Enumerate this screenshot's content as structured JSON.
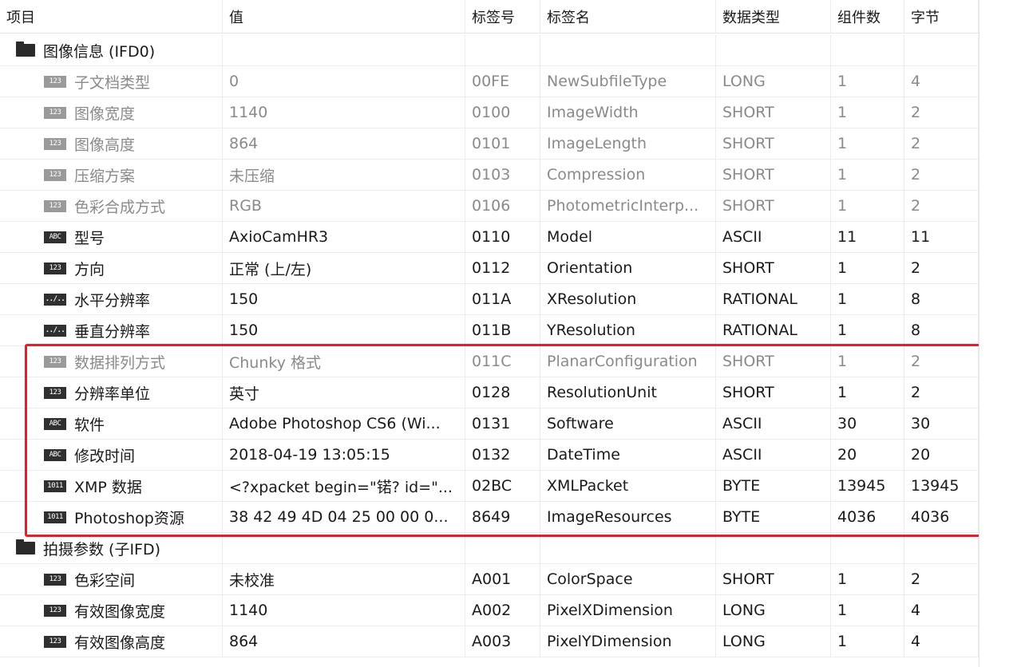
{
  "headers": [
    "项目",
    "值",
    "标签号",
    "标签名",
    "数据类型",
    "组件数",
    "字节"
  ],
  "rows": [
    {
      "kind": "group",
      "name": "图像信息 (IFD0)"
    },
    {
      "kind": "entry",
      "dim": true,
      "icon": "123",
      "name": "子文档类型",
      "value": "0",
      "tag": "00FE",
      "tagname": "NewSubfileType",
      "type": "LONG",
      "count": "1",
      "bytes": "4"
    },
    {
      "kind": "entry",
      "dim": true,
      "icon": "123",
      "name": "图像宽度",
      "value": "1140",
      "tag": "0100",
      "tagname": "ImageWidth",
      "type": "SHORT",
      "count": "1",
      "bytes": "2"
    },
    {
      "kind": "entry",
      "dim": true,
      "icon": "123",
      "name": "图像高度",
      "value": "864",
      "tag": "0101",
      "tagname": "ImageLength",
      "type": "SHORT",
      "count": "1",
      "bytes": "2"
    },
    {
      "kind": "entry",
      "dim": true,
      "icon": "123",
      "name": "压缩方案",
      "value": "未压缩",
      "tag": "0103",
      "tagname": "Compression",
      "type": "SHORT",
      "count": "1",
      "bytes": "2"
    },
    {
      "kind": "entry",
      "dim": true,
      "icon": "123",
      "name": "色彩合成方式",
      "value": "RGB",
      "tag": "0106",
      "tagname": "PhotometricInterp...",
      "type": "SHORT",
      "count": "1",
      "bytes": "2"
    },
    {
      "kind": "entry",
      "dim": false,
      "icon": "ABC",
      "name": "型号",
      "value": "AxioCamHR3",
      "tag": "0110",
      "tagname": "Model",
      "type": "ASCII",
      "count": "11",
      "bytes": "11"
    },
    {
      "kind": "entry",
      "dim": false,
      "icon": "123",
      "name": "方向",
      "value": "正常 (上/左)",
      "tag": "0112",
      "tagname": "Orientation",
      "type": "SHORT",
      "count": "1",
      "bytes": "2"
    },
    {
      "kind": "entry",
      "dim": false,
      "icon": "../..",
      "name": "水平分辨率",
      "value": "150",
      "tag": "011A",
      "tagname": "XResolution",
      "type": "RATIONAL",
      "count": "1",
      "bytes": "8"
    },
    {
      "kind": "entry",
      "dim": false,
      "icon": "../..",
      "name": "垂直分辨率",
      "value": "150",
      "tag": "011B",
      "tagname": "YResolution",
      "type": "RATIONAL",
      "count": "1",
      "bytes": "8"
    },
    {
      "kind": "entry",
      "dim": true,
      "icon": "123",
      "name": "数据排列方式",
      "value": "Chunky 格式",
      "tag": "011C",
      "tagname": "PlanarConfiguration",
      "type": "SHORT",
      "count": "1",
      "bytes": "2"
    },
    {
      "kind": "entry",
      "dim": false,
      "icon": "123",
      "name": "分辨率单位",
      "value": "英寸",
      "tag": "0128",
      "tagname": "ResolutionUnit",
      "type": "SHORT",
      "count": "1",
      "bytes": "2"
    },
    {
      "kind": "entry",
      "dim": false,
      "icon": "ABC",
      "name": "软件",
      "value": "Adobe Photoshop CS6 (Wi...",
      "tag": "0131",
      "tagname": "Software",
      "type": "ASCII",
      "count": "30",
      "bytes": "30"
    },
    {
      "kind": "entry",
      "dim": false,
      "icon": "ABC",
      "name": "修改时间",
      "value": "2018-04-19 13:05:15",
      "tag": "0132",
      "tagname": "DateTime",
      "type": "ASCII",
      "count": "20",
      "bytes": "20"
    },
    {
      "kind": "entry",
      "dim": false,
      "icon": "1011",
      "name": "XMP 数据",
      "value": "<?xpacket begin=\"锘? id=\"...",
      "tag": "02BC",
      "tagname": "XMLPacket",
      "type": "BYTE",
      "count": "13945",
      "bytes": "13945"
    },
    {
      "kind": "entry",
      "dim": false,
      "icon": "1011",
      "name": "Photoshop资源",
      "value": "38 42 49 4D 04 25 00 00 0...",
      "tag": "8649",
      "tagname": "ImageResources",
      "type": "BYTE",
      "count": "4036",
      "bytes": "4036"
    },
    {
      "kind": "group",
      "name": "拍摄参数 (子IFD)"
    },
    {
      "kind": "entry",
      "dim": false,
      "icon": "123",
      "name": "色彩空间",
      "value": "未校准",
      "tag": "A001",
      "tagname": "ColorSpace",
      "type": "SHORT",
      "count": "1",
      "bytes": "2"
    },
    {
      "kind": "entry",
      "dim": false,
      "icon": "123",
      "name": "有效图像宽度",
      "value": "1140",
      "tag": "A002",
      "tagname": "PixelXDimension",
      "type": "LONG",
      "count": "1",
      "bytes": "4"
    },
    {
      "kind": "entry",
      "dim": false,
      "icon": "123",
      "name": "有效图像高度",
      "value": "864",
      "tag": "A003",
      "tagname": "PixelYDimension",
      "type": "LONG",
      "count": "1",
      "bytes": "4"
    }
  ],
  "highlight_color": "#e2202c",
  "text_color": "#1a1a1a",
  "dim_text_color": "#8a8a8a"
}
